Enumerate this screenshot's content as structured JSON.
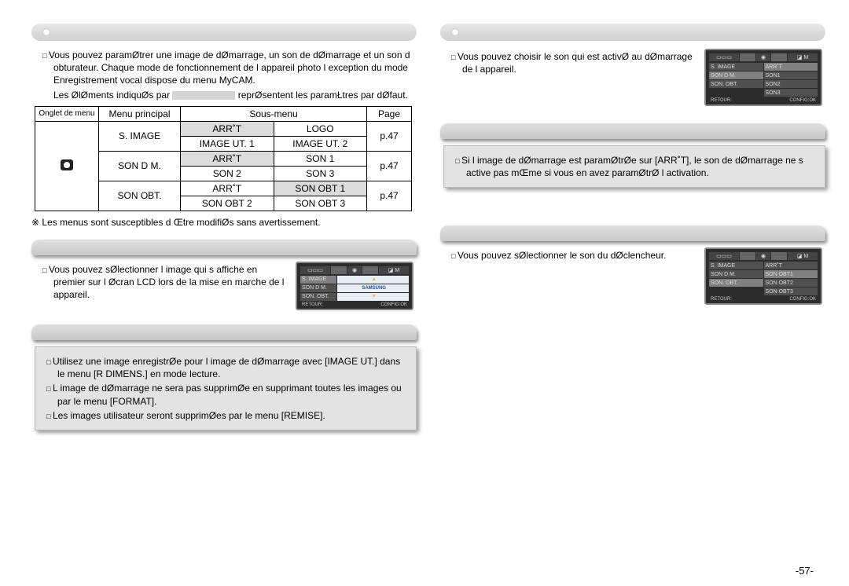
{
  "left": {
    "intro": "Vous pouvez paramØtrer une image de dØmarrage, un son de dØmarrage et un son d obturateur. Chaque mode de fonctionnement de l appareil photo l exception du mode Enregistrement vocal dispose du menu MyCAM.",
    "default_note_before": "Les ØlØments indiquØs par",
    "default_note_after": "reprØsentent les paramŁtres par dØfaut.",
    "table": {
      "headers": [
        "Onglet de menu",
        "Menu principal",
        "Sous-menu",
        "Page"
      ],
      "rows": [
        {
          "main": "S. IMAGE",
          "sub": [
            {
              "t": "ARR˚T",
              "sh": true
            },
            {
              "t": "LOGO"
            },
            {
              "t": "IMAGE UT. 1"
            },
            {
              "t": "IMAGE UT. 2"
            }
          ],
          "page": "p.47"
        },
        {
          "main": "SON D M.",
          "sub": [
            {
              "t": "ARR˚T",
              "sh": true
            },
            {
              "t": "SON 1"
            },
            {
              "t": "SON 2"
            },
            {
              "t": "SON 3"
            }
          ],
          "page": "p.47"
        },
        {
          "main": "SON  OBT.",
          "sub": [
            {
              "t": "ARR˚T"
            },
            {
              "t": "SON OBT 1",
              "sh": true
            },
            {
              "t": "SON OBT 2"
            },
            {
              "t": "SON OBT 3"
            }
          ],
          "page": "p.47"
        }
      ]
    },
    "modif_note": "Les menus sont susceptibles d Œtre modifiØs sans avertissement.",
    "image_section_text": "Vous pouvez sØlectionner l image qui s affiche en premier sur l Øcran LCD lors de la mise en marche de l appareil.",
    "infobox": [
      "Utilisez une image enregistrØe pour l image de dØmarrage avec [IMAGE UT.] dans le menu [R DIMENS.] en mode lecture.",
      "L image de dØmarrage ne sera pas supprimØe en supprimant toutes les images ou par le menu [FORMAT].",
      "Les images utilisateur seront supprimØes par le menu [REMISE]."
    ],
    "lcd_image": {
      "left_items": [
        "S. IMAGE",
        "SON D M.",
        "SON. OBT."
      ],
      "foot_left": "RETOUR:",
      "foot_right": "CONFIG:OK"
    }
  },
  "right": {
    "sound_start_text": "Vous pouvez choisir le son qui est activØ au dØmarrage de l appareil.",
    "infobox": [
      "Si l image de dØmarrage est paramØtrØe sur [ARR˚T], le son de dØmarrage ne s active pas mŒme si vous en avez paramØtrØ l activation."
    ],
    "shutter_text": "Vous pouvez sØlectionner le son du dØclencheur.",
    "lcd_sound": {
      "left_items": [
        "S. IMAGE",
        "SON D M.",
        "SON. OBT."
      ],
      "right_items": [
        "ARR˚T",
        "SON1",
        "SON2",
        "SON3"
      ],
      "foot_left": "RETOUR:",
      "foot_right": "CONFIG:OK"
    },
    "lcd_shutter": {
      "left_items": [
        "S. IMAGE",
        "SON D M.",
        "SON. OBT."
      ],
      "right_items": [
        "ARR˚T",
        "SON OBT1",
        "SON OBT2",
        "SON OBT3"
      ],
      "foot_left": "RETOUR:",
      "foot_right": "CONFIG:OK"
    }
  },
  "page_number": "-57-",
  "icons": {
    "tab_strip": [
      "◻◻◻",
      " ",
      " ",
      "◪",
      "M"
    ]
  }
}
